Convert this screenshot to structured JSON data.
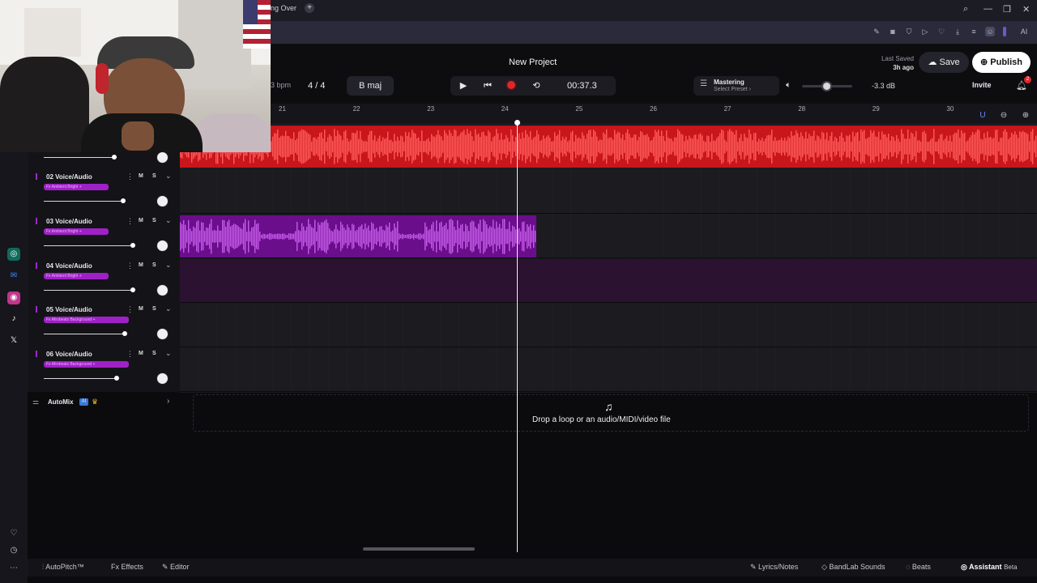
{
  "browser": {
    "tab_label": "ng Over",
    "new_tab": "+",
    "win_search": "⌕",
    "win_min": "—",
    "win_max": "❐",
    "win_close": "✕",
    "ext_ai": "AI"
  },
  "header": {
    "title": "New Project",
    "last_saved_label": "Last Saved",
    "last_saved_time": "3h ago",
    "save_label": "Save",
    "publish_label": "Publish",
    "invite_label": "Invite",
    "notif_count": "2"
  },
  "transport": {
    "bpm": "3 bpm",
    "time_signature": "4 / 4",
    "key": "B maj",
    "time": "00:37.3"
  },
  "mastering": {
    "label": "Mastering",
    "sub": "Select Preset ›"
  },
  "volume": {
    "db": "-3.3 dB",
    "level": 0.48
  },
  "ruler": {
    "bars": [
      "21",
      "22",
      "23",
      "24",
      "25",
      "26",
      "27",
      "28",
      "29",
      "30"
    ]
  },
  "tracks": [
    {
      "name": "02 Voice/Audio",
      "tag": "Fx Ambient Bright +",
      "m": "M",
      "s": "S"
    },
    {
      "name": "03 Voice/Audio",
      "tag": "Fx Ambient Bright +",
      "m": "M",
      "s": "S"
    },
    {
      "name": "04 Voice/Audio",
      "tag": "Fx Ambient Bright +",
      "m": "M",
      "s": "S"
    },
    {
      "name": "05 Voice/Audio",
      "tag": "Fx Afrobeats Background +",
      "m": "M",
      "s": "S"
    },
    {
      "name": "06 Voice/Audio",
      "tag": "Fx Afrobeats Background +",
      "m": "M",
      "s": "S"
    }
  ],
  "automix": {
    "label": "AutoMix",
    "ai": "AI"
  },
  "drop_zone": {
    "text": "Drop a loop or an audio/MIDI/video file"
  },
  "bottom": {
    "autopitch": "AutoPitch™",
    "effects": "Effects",
    "editor": "Editor",
    "lyrics": "Lyrics/Notes",
    "sounds": "BandLab Sounds",
    "beats": "Beats",
    "assistant": "Assistant",
    "beta": "Beta"
  },
  "colors": {
    "accent_red": "#e0262c",
    "accent_purple": "#a020c8",
    "background": "#0b0b0e"
  },
  "icons": [
    "search-icon",
    "play-icon",
    "skip-back-icon",
    "record-icon",
    "loop-icon",
    "speaker-icon",
    "bell-icon",
    "heart-icon",
    "clock-icon",
    "more-icon",
    "magnet-icon",
    "zoom-out-icon",
    "zoom-in-icon"
  ]
}
